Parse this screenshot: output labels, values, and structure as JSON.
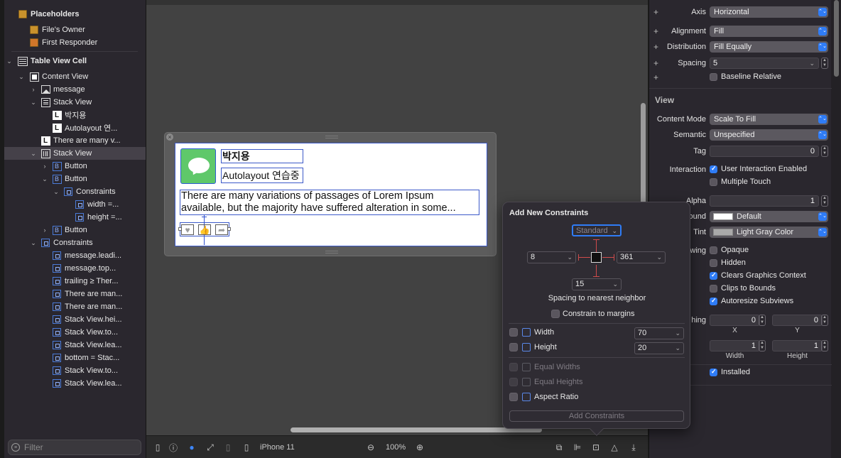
{
  "outline": {
    "placeholders": "Placeholders",
    "files_owner": "File's Owner",
    "first_responder": "First Responder",
    "table_view_cell": "Table View Cell",
    "content_view": "Content View",
    "message": "message",
    "stack_view": "Stack View",
    "label_name": "박지용",
    "label_autolayout": "Autolayout 연...",
    "label_there": "There are many v...",
    "stack_view_2": "Stack View",
    "button": "Button",
    "constraints": "Constraints",
    "width_c": "width =...",
    "height_c": "height =...",
    "constraint_items": [
      "message.leadi...",
      "message.top...",
      "trailing ≥ Ther...",
      "There are man...",
      "There are man...",
      "Stack View.hei...",
      "Stack View.to...",
      "Stack View.lea...",
      "bottom = Stac...",
      "Stack View.to...",
      "Stack View.lea..."
    ],
    "filter_placeholder": "Filter"
  },
  "canvas": {
    "cell_name": "박지용",
    "cell_subtitle": "Autolayout 연습중",
    "cell_body": "There are many variations of passages of Lorem Ipsum available, but the majority have suffered alteration in some...",
    "buttons": [
      "♥",
      "👍",
      "➦"
    ]
  },
  "bottom_bar": {
    "device": "iPhone 11",
    "zoom": "100%"
  },
  "popover": {
    "title": "Add New Constraints",
    "top_value": "Standard",
    "left_value": "8",
    "right_value": "361",
    "bottom_value": "15",
    "spacing_label": "Spacing to nearest neighbor",
    "constrain_margins": "Constrain to margins",
    "width_label": "Width",
    "width_value": "70",
    "height_label": "Height",
    "height_value": "20",
    "equal_widths": "Equal Widths",
    "equal_heights": "Equal Heights",
    "aspect_ratio": "Aspect Ratio",
    "add_button": "Add Constraints"
  },
  "inspector": {
    "axis_label": "Axis",
    "axis_value": "Horizontal",
    "alignment_label": "Alignment",
    "alignment_value": "Fill",
    "distribution_label": "Distribution",
    "distribution_value": "Fill Equally",
    "spacing_label": "Spacing",
    "spacing_value": "5",
    "baseline_relative": "Baseline Relative",
    "view_section": "View",
    "content_mode_label": "Content Mode",
    "content_mode_value": "Scale To Fill",
    "semantic_label": "Semantic",
    "semantic_value": "Unspecified",
    "tag_label": "Tag",
    "tag_value": "0",
    "interaction_label": "Interaction",
    "user_interaction": "User Interaction Enabled",
    "multiple_touch": "Multiple Touch",
    "alpha_label": "Alpha",
    "alpha_value": "1",
    "background_label": "ound",
    "background_value": "Default",
    "tint_label": "Tint",
    "tint_value": "Light Gray Color",
    "drawing_label": "wing",
    "opaque": "Opaque",
    "hidden": "Hidden",
    "clears_graphics": "Clears Graphics Context",
    "clips_bounds": "Clips to Bounds",
    "autoresize": "Autoresize Subviews",
    "stretching_label": "hing",
    "x_value": "0",
    "y_value": "0",
    "x_caption": "X",
    "y_caption": "Y",
    "w_value": "1",
    "h_value": "1",
    "w_caption": "Width",
    "h_caption": "Height",
    "installed": "Installed"
  },
  "colors": {
    "accent": "#2f7cf6",
    "selection": "#454149",
    "constraint_blue": "#3c59c9"
  }
}
